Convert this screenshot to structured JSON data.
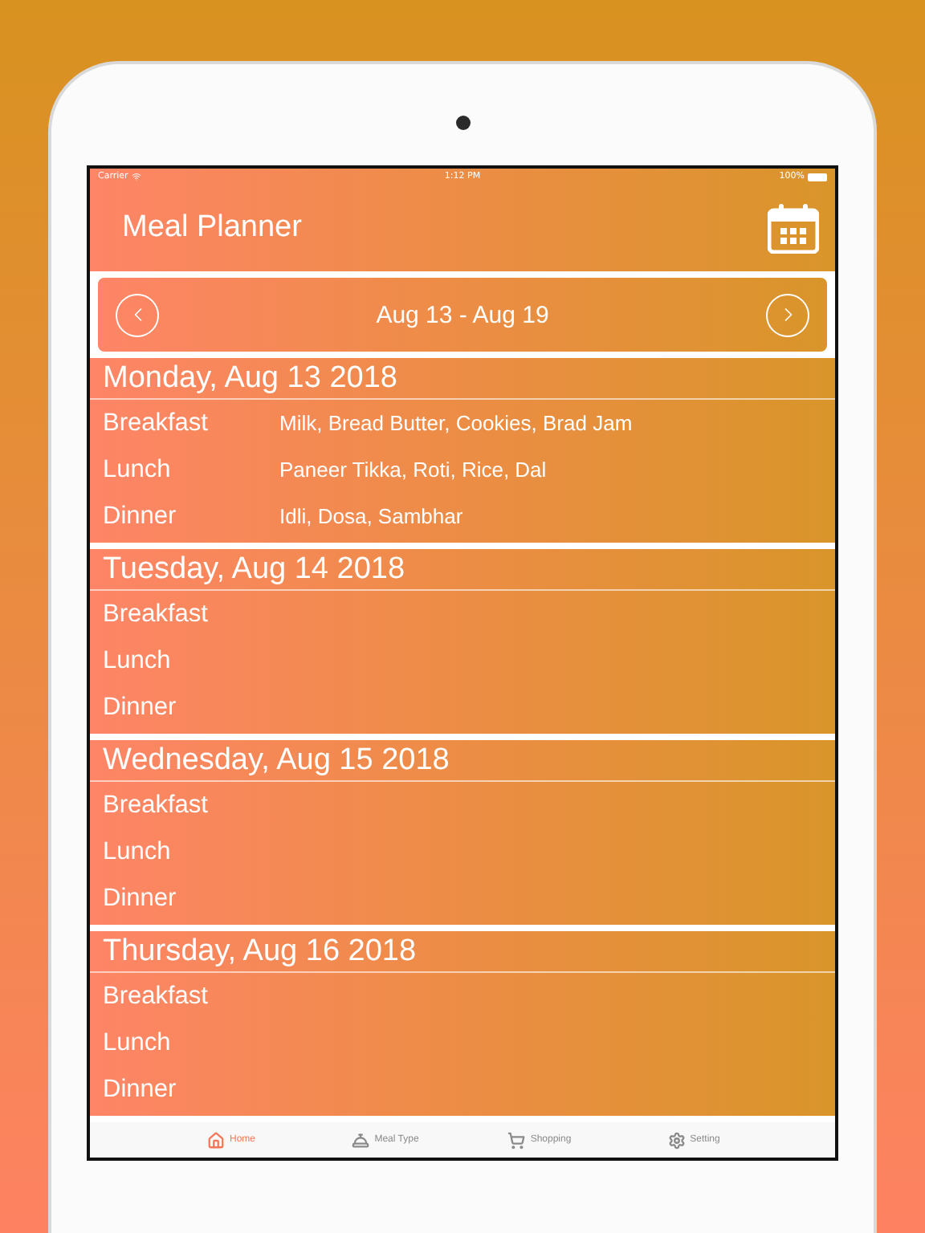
{
  "status_bar": {
    "carrier": "Carrier",
    "time": "1:12 PM",
    "battery": "100%"
  },
  "header": {
    "title": "Meal Planner"
  },
  "week": {
    "label": "Aug 13 - Aug 19"
  },
  "days": [
    {
      "title": "Monday, Aug 13 2018",
      "meals": [
        {
          "name": "Breakfast",
          "items": "Milk, Bread Butter, Cookies, Brad Jam"
        },
        {
          "name": "Lunch",
          "items": "Paneer Tikka, Roti, Rice, Dal"
        },
        {
          "name": "Dinner",
          "items": "Idli, Dosa, Sambhar"
        }
      ]
    },
    {
      "title": "Tuesday, Aug 14 2018",
      "meals": [
        {
          "name": "Breakfast"
        },
        {
          "name": "Lunch"
        },
        {
          "name": "Dinner"
        }
      ]
    },
    {
      "title": "Wednesday, Aug 15 2018",
      "meals": [
        {
          "name": "Breakfast"
        },
        {
          "name": "Lunch"
        },
        {
          "name": "Dinner"
        }
      ]
    },
    {
      "title": "Thursday, Aug 16 2018",
      "meals": [
        {
          "name": "Breakfast"
        },
        {
          "name": "Lunch"
        },
        {
          "name": "Dinner"
        }
      ]
    }
  ],
  "tabs": [
    {
      "label": "Home",
      "kind": "home",
      "selected": true
    },
    {
      "label": "Meal Type",
      "kind": "dish",
      "selected": false
    },
    {
      "label": "Shopping",
      "kind": "cart",
      "selected": false
    },
    {
      "label": "Setting",
      "kind": "gear",
      "selected": false
    }
  ]
}
